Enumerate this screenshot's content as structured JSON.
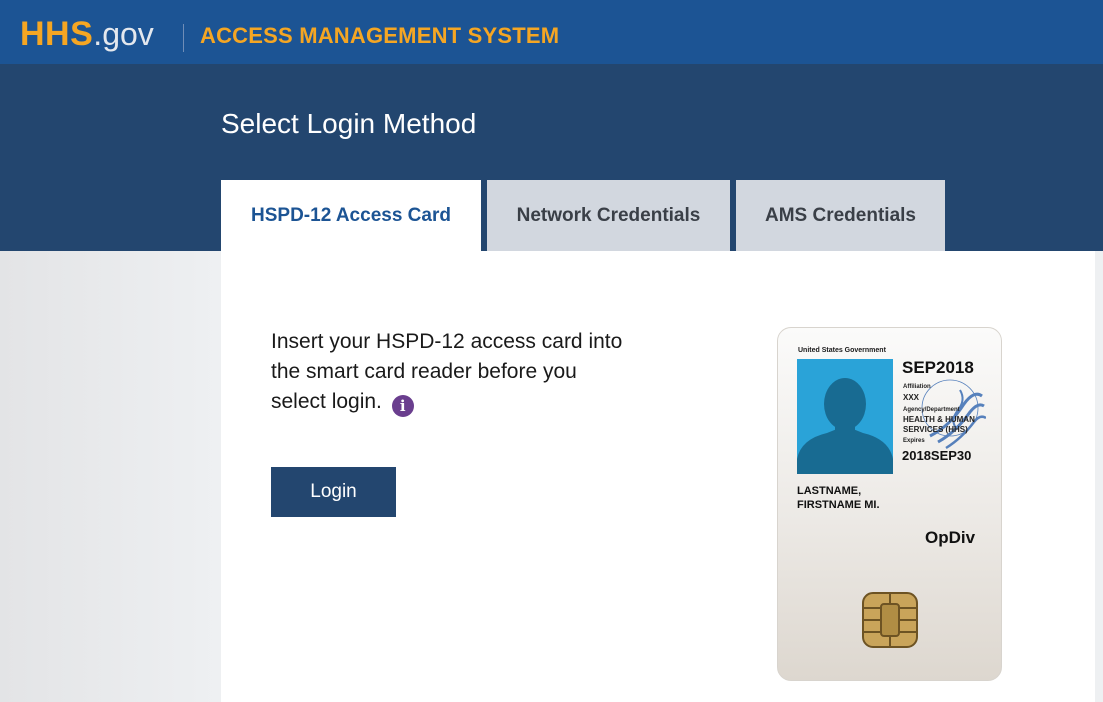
{
  "header": {
    "logo_hhs": "HHS",
    "logo_gov": ".gov",
    "system_title": "ACCESS MANAGEMENT SYSTEM"
  },
  "banner": {
    "page_title": "Select Login Method"
  },
  "tabs": [
    {
      "label": "HSPD-12 Access Card",
      "active": true
    },
    {
      "label": "Network Credentials",
      "active": false
    },
    {
      "label": "AMS Credentials",
      "active": false
    }
  ],
  "main": {
    "instructions": "Insert your HSPD-12 access card into the smart card reader before you select login.",
    "info_icon": "info-icon",
    "login_label": "Login"
  },
  "card": {
    "government": "United States Government",
    "expiry": "SEP2018",
    "affiliation_label": "Affiliation",
    "affiliation_value": "XXX",
    "agency_label": "Agency/Department",
    "agency_line1": "HEALTH & HUMAN",
    "agency_line2": "SERVICES (HHS)",
    "expires_label": "Expires",
    "expires_value": "2018SEP30",
    "name_line1": "LASTNAME,",
    "name_line2": "FIRSTNAME MI.",
    "opdiv": "OpDiv"
  },
  "colors": {
    "topbar": "#1c5494",
    "banner": "#23466f",
    "accent": "#f5a623",
    "active_tab_text": "#1c5494",
    "inactive_tab_bg": "#d2d7df",
    "info_icon": "#6a3e8e",
    "button": "#23466f"
  }
}
